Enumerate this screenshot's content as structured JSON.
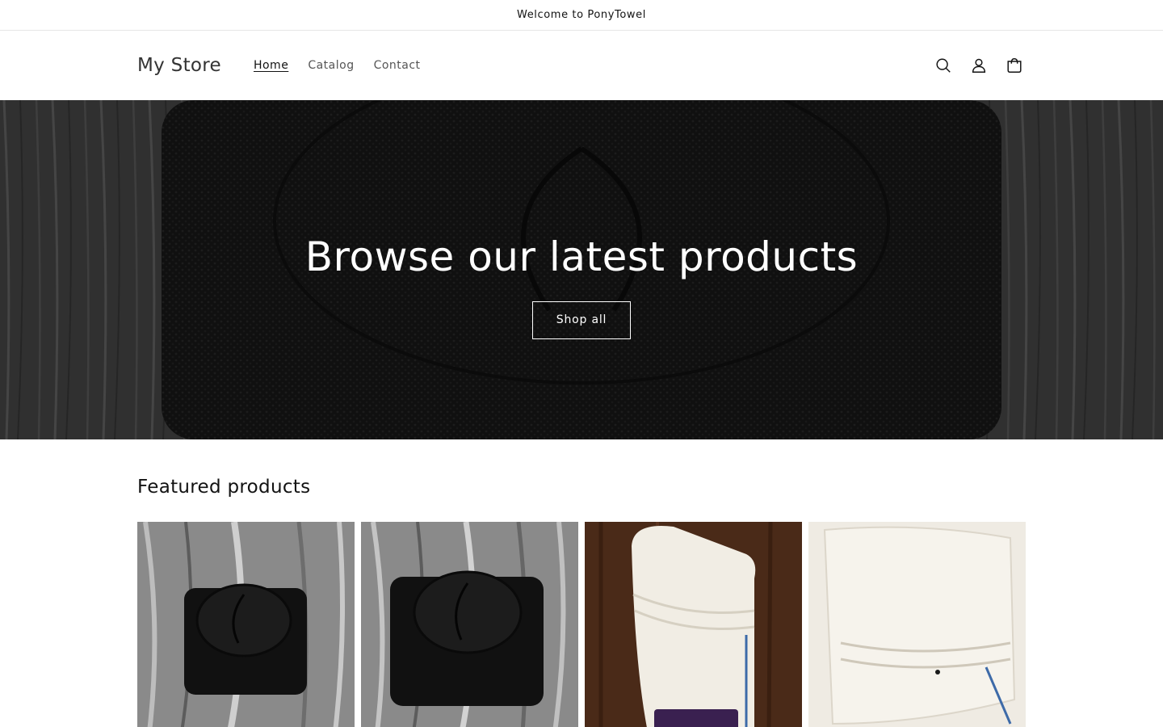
{
  "announcement": {
    "text": "Welcome to PonyTowel"
  },
  "header": {
    "logo": "My Store",
    "nav": [
      {
        "label": "Home",
        "active": true
      },
      {
        "label": "Catalog",
        "active": false
      },
      {
        "label": "Contact",
        "active": false
      }
    ],
    "icons": [
      "search-icon",
      "account-icon",
      "cart-icon"
    ]
  },
  "hero": {
    "title": "Browse our latest products",
    "button_label": "Shop all"
  },
  "featured": {
    "title": "Featured products",
    "products": [
      {
        "image": "black-towel-wrap-on-wood"
      },
      {
        "image": "black-towel-wrap-on-wood"
      },
      {
        "image": "white-towel-with-label-on-dark-wood"
      },
      {
        "image": "white-towel-folded"
      }
    ]
  },
  "colors": {
    "text": "#121212",
    "border": "#e6e6e6",
    "hero_dark": "#1f1f1f",
    "white": "#ffffff"
  }
}
